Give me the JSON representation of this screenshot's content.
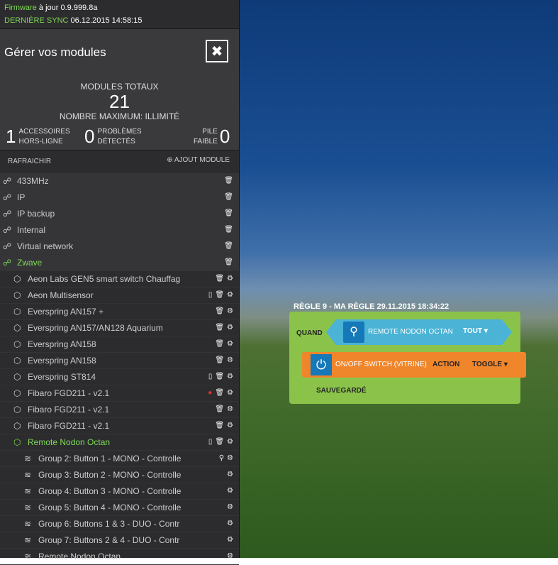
{
  "colors": {
    "accent_green": "#7ed957",
    "sidebar_bg": "#2c2c2e",
    "trigger_blue": "#4ab3d6",
    "action_orange": "#f0862c",
    "rule_green": "#8bc34a"
  },
  "status": {
    "firmware_label": "Firmware",
    "firmware_text": "à jour 0.9.999.8a",
    "sync_label": "DERNIÈRE SYNC",
    "sync_value": "06.12.2015 14:58:15"
  },
  "header": {
    "title": "Gérer vos modules",
    "button_icon": "satellite-icon"
  },
  "stats": {
    "total_label": "MODULES TOTAUX",
    "total_value": "21",
    "max_label": "NOMBRE MAXIMUM: ILLIMITÉ",
    "offline_count": "1",
    "offline_line1": "ACCESSOIRES",
    "offline_line2": "HORS-LIGNE",
    "problems_count": "0",
    "problems_line1": "PROBLÈMES",
    "problems_line2": "DÉTECTÉS",
    "battery_line1": "PILE",
    "battery_line2": "FAIBLE",
    "battery_count": "0"
  },
  "actions": {
    "refresh": "RAFRAICHIR",
    "add_module": "AJOUT MODULE"
  },
  "rows": [
    {
      "label": "433MHz",
      "level": 0,
      "kind": "network",
      "green": false,
      "tools": "trash"
    },
    {
      "label": "IP",
      "level": 0,
      "kind": "network",
      "green": false,
      "tools": "trash"
    },
    {
      "label": "IP backup",
      "level": 0,
      "kind": "network",
      "green": false,
      "tools": "trash"
    },
    {
      "label": "Internal",
      "level": 0,
      "kind": "network",
      "green": false,
      "tools": "trash"
    },
    {
      "label": "Virtual network",
      "level": 0,
      "kind": "network",
      "green": false,
      "tools": "trash"
    },
    {
      "label": "Zwave",
      "level": 0,
      "kind": "network",
      "green": true,
      "tools": "trash"
    },
    {
      "label": "Aeon Labs GEN5 smart switch Chauffag",
      "level": 1,
      "kind": "device",
      "green": false,
      "tools": "trash-gear"
    },
    {
      "label": "Aeon Multisensor",
      "level": 1,
      "kind": "device",
      "green": false,
      "tools": "battery-trash-gear"
    },
    {
      "label": "Everspring AN157 +",
      "level": 1,
      "kind": "device",
      "green": false,
      "tools": "trash-gear"
    },
    {
      "label": "Everspring AN157/AN128 Aquarium",
      "level": 1,
      "kind": "device",
      "green": false,
      "tools": "trash-gear"
    },
    {
      "label": "Everspring AN158",
      "level": 1,
      "kind": "device",
      "green": false,
      "tools": "trash-gear"
    },
    {
      "label": "Everspring AN158",
      "level": 1,
      "kind": "device",
      "green": false,
      "tools": "trash-gear"
    },
    {
      "label": "Everspring ST814",
      "level": 1,
      "kind": "device",
      "green": false,
      "tools": "battery-trash-gear"
    },
    {
      "label": "Fibaro FGD211 - v2.1",
      "level": 1,
      "kind": "device",
      "green": false,
      "tools": "dot-trash-gear"
    },
    {
      "label": "Fibaro FGD211 - v2.1",
      "level": 1,
      "kind": "device",
      "green": false,
      "tools": "trash-gear"
    },
    {
      "label": "Fibaro FGD211 - v2.1",
      "level": 1,
      "kind": "device",
      "green": false,
      "tools": "trash-gear"
    },
    {
      "label": "Remote Nodon Octan",
      "level": 1,
      "kind": "device",
      "green": true,
      "tools": "battery-trash-gear"
    },
    {
      "label": "Group 2: Button 1 - MONO - Controlle",
      "level": 2,
      "kind": "group",
      "green": false,
      "tools": "pin-gear"
    },
    {
      "label": "Group 3: Button 2 - MONO - Controlle",
      "level": 2,
      "kind": "group",
      "green": false,
      "tools": "gear"
    },
    {
      "label": "Group 4: Button 3 - MONO - Controlle",
      "level": 2,
      "kind": "group",
      "green": false,
      "tools": "gear"
    },
    {
      "label": "Group 5: Button 4 - MONO - Controlle",
      "level": 2,
      "kind": "group",
      "green": false,
      "tools": "gear"
    },
    {
      "label": "Group 6: Buttons 1 & 3 - DUO - Contr",
      "level": 2,
      "kind": "group",
      "green": false,
      "tools": "gear"
    },
    {
      "label": "Group 7: Buttons 2 & 4 - DUO - Contr",
      "level": 2,
      "kind": "group",
      "green": false,
      "tools": "gear"
    },
    {
      "label": "Remote Nodon Octan",
      "level": 2,
      "kind": "group",
      "green": false,
      "tools": "gear"
    }
  ],
  "rule": {
    "title": "RÈGLE 9 - MA RÈGLE 29.11.2015 18:34:22",
    "when_label": "QUAND",
    "trigger_device": "REMOTE NODON OCTAN",
    "trigger_option": "TOUT",
    "action_device": "ON/OFF SWITCH (VITRINE)",
    "action_label": "ACTION",
    "action_option": "TOGGLE",
    "saved_label": "SAUVEGARDÉ"
  }
}
